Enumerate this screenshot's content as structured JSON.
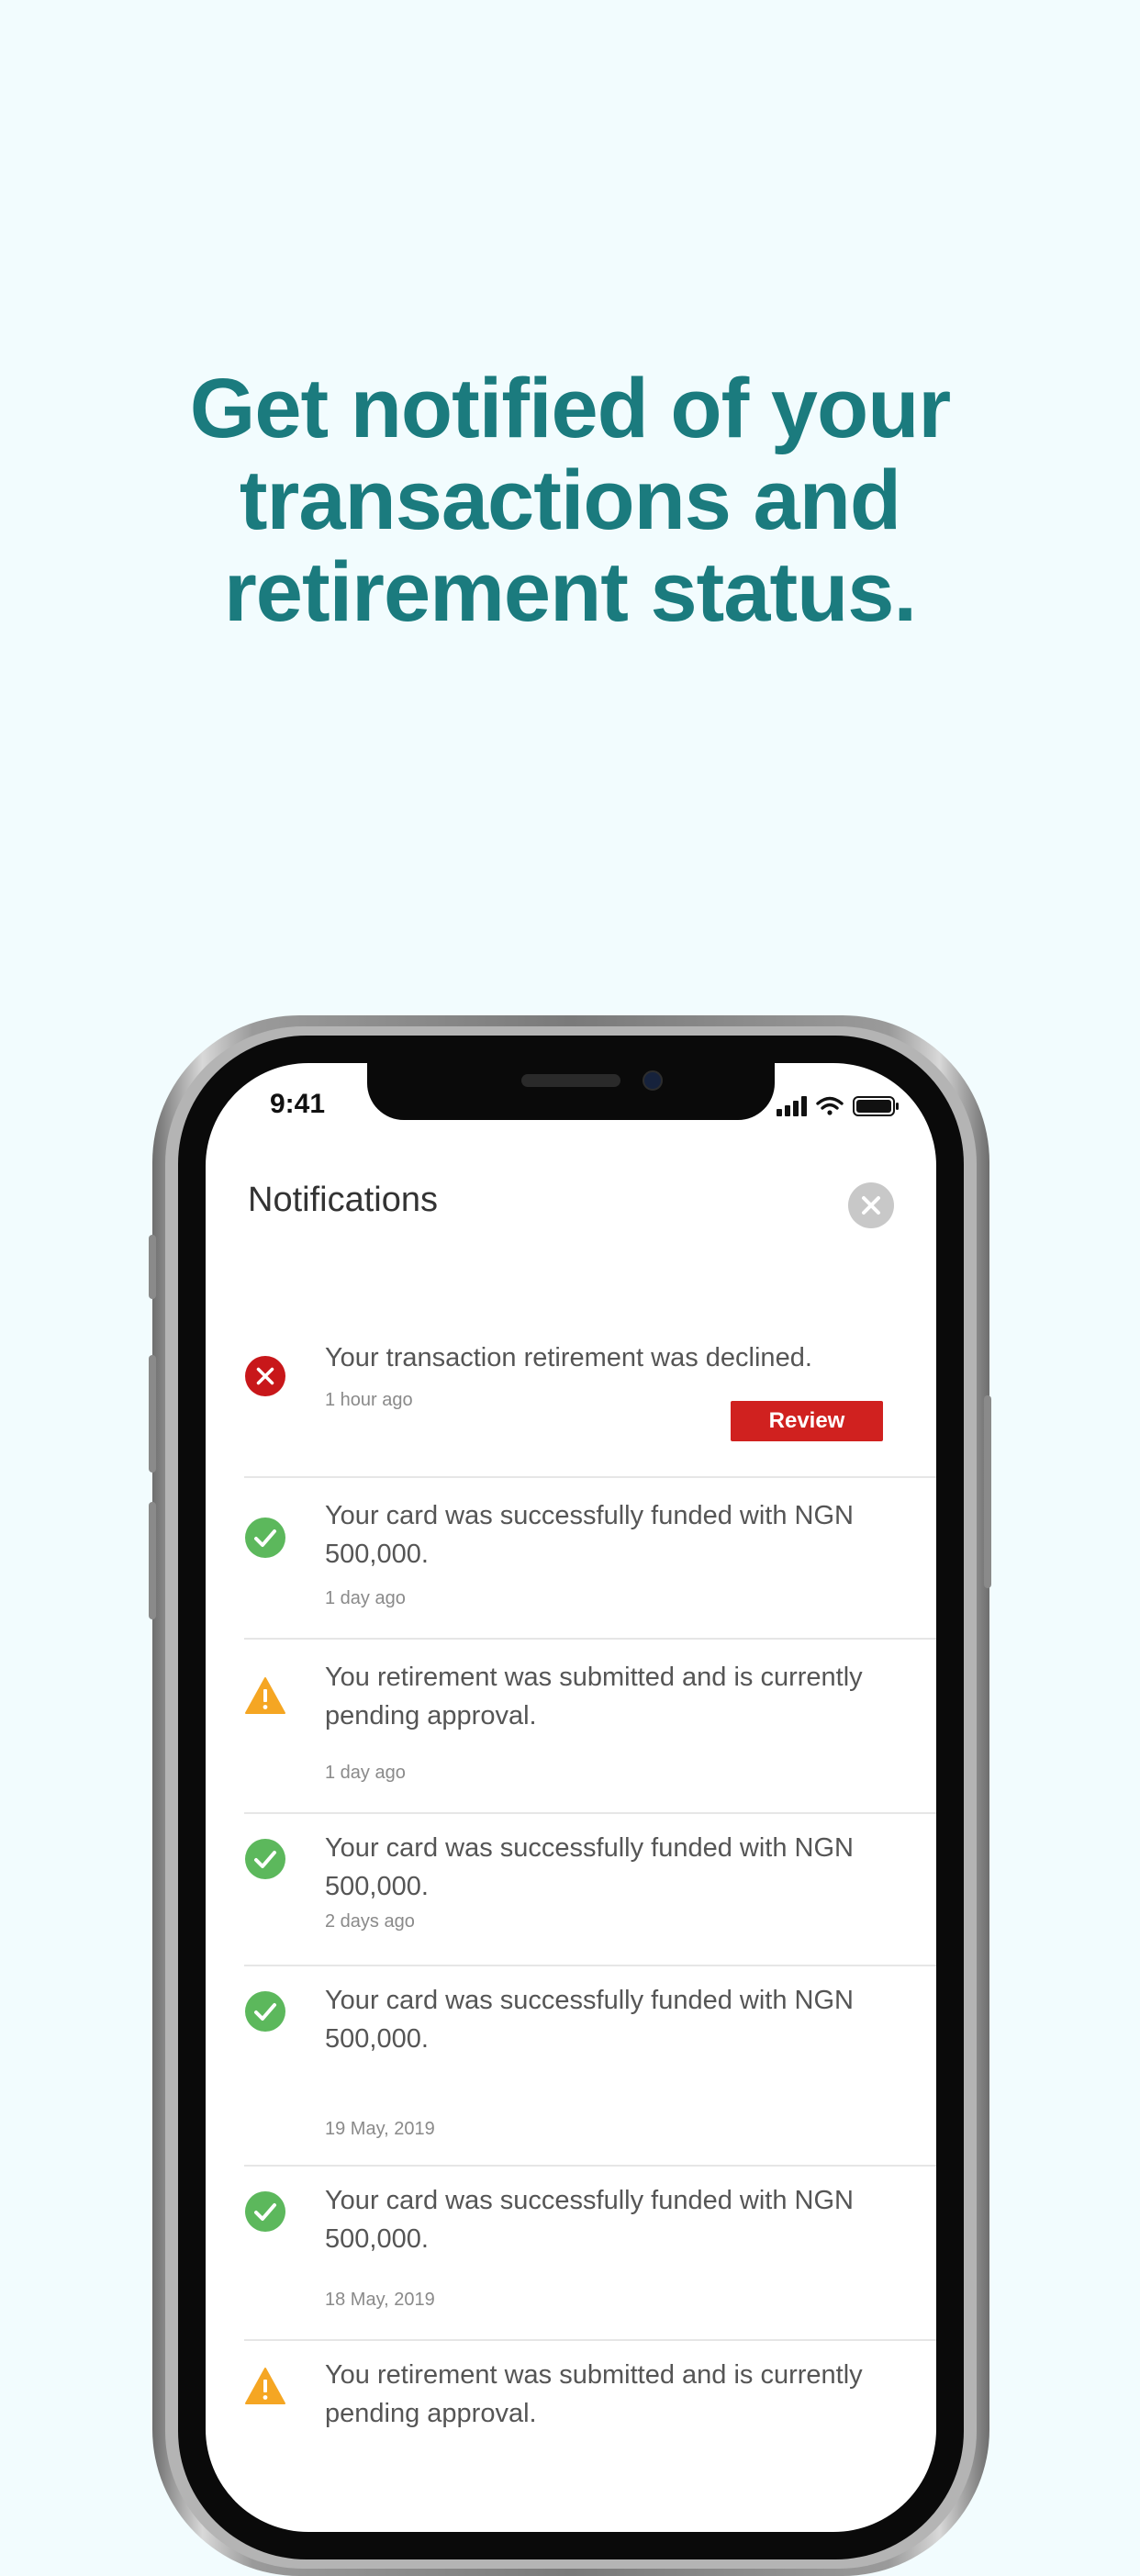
{
  "headline": {
    "line1": "Get notified of your",
    "line2": "transactions and",
    "line3": "retirement status."
  },
  "status_bar": {
    "time": "9:41"
  },
  "screen": {
    "title": "Notifications",
    "close_icon": "close-icon"
  },
  "colors": {
    "headline": "#1b7b7e",
    "error": "#d0211f",
    "success": "#5cb85c",
    "warning": "#f5a623"
  },
  "notifications": [
    {
      "type": "error",
      "icon": "error-icon",
      "message": "Your transaction retirement was declined.",
      "time": "1 hour ago",
      "action": "Review"
    },
    {
      "type": "success",
      "icon": "check-icon",
      "message": "Your card was successfully funded with NGN 500,000.",
      "time": "1 day ago"
    },
    {
      "type": "warning",
      "icon": "warning-icon",
      "message": "You retirement was submitted and is currently pending approval.",
      "time": "1 day ago"
    },
    {
      "type": "success",
      "icon": "check-icon",
      "message": "Your card was successfully funded with NGN 500,000.",
      "time": "2 days ago"
    },
    {
      "type": "success",
      "icon": "check-icon",
      "message": "Your card was successfully funded with NGN 500,000.",
      "time": "19 May, 2019"
    },
    {
      "type": "success",
      "icon": "check-icon",
      "message": "Your card was successfully funded with NGN 500,000.",
      "time": "18 May, 2019"
    },
    {
      "type": "warning",
      "icon": "warning-icon",
      "message": "You retirement was submitted and is currently pending approval."
    }
  ]
}
